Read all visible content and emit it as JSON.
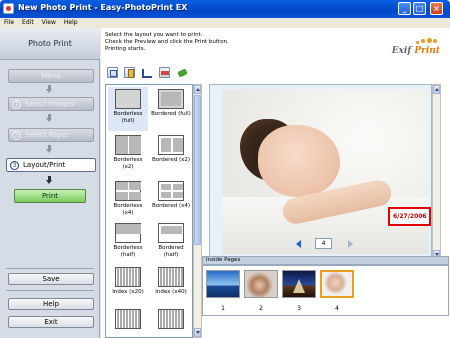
{
  "window": {
    "title": "New Photo Print - Easy-PhotoPrint EX"
  },
  "menu": [
    "File",
    "Edit",
    "View",
    "Help"
  ],
  "sidebar": {
    "title": "Photo Print",
    "steps": [
      {
        "num": "",
        "label": "Menu"
      },
      {
        "num": "1",
        "label": "Select Images"
      },
      {
        "num": "2",
        "label": "Select Paper"
      },
      {
        "num": "3",
        "label": "Layout/Print"
      }
    ],
    "print_label": "Print",
    "save_label": "Save",
    "help_label": "Help",
    "exit_label": "Exit"
  },
  "instructions": {
    "line1": "Select the layout you want to print.",
    "line2": "Check the Preview and click the Print button.",
    "line3": "Printing starts."
  },
  "logo": {
    "prefix": "Exif",
    "suffix": "Print"
  },
  "toolbar": {
    "icons": [
      "rotate-icon",
      "image-copy-icon",
      "crop-icon",
      "date-icon",
      "correct-image-icon"
    ]
  },
  "layouts": [
    {
      "l1": "Borderless",
      "l2": "(full)"
    },
    {
      "l1": "Bordered (full)",
      "l2": ""
    },
    {
      "l1": "Borderless",
      "l2": "(x2)"
    },
    {
      "l1": "Bordered (x2)",
      "l2": ""
    },
    {
      "l1": "Borderless",
      "l2": "(x4)"
    },
    {
      "l1": "Bordered (x4)",
      "l2": ""
    },
    {
      "l1": "Borderless",
      "l2": "(half)"
    },
    {
      "l1": "Bordered",
      "l2": "(half)"
    },
    {
      "l1": "Index (x20)",
      "l2": ""
    },
    {
      "l1": "Index (x40)",
      "l2": ""
    }
  ],
  "preview": {
    "date_stamp": "6/27/2006"
  },
  "pager": {
    "current": "4"
  },
  "inside_pages": {
    "title": "Inside Pages",
    "pages": [
      "1",
      "2",
      "3",
      "4"
    ],
    "selected": "4"
  }
}
